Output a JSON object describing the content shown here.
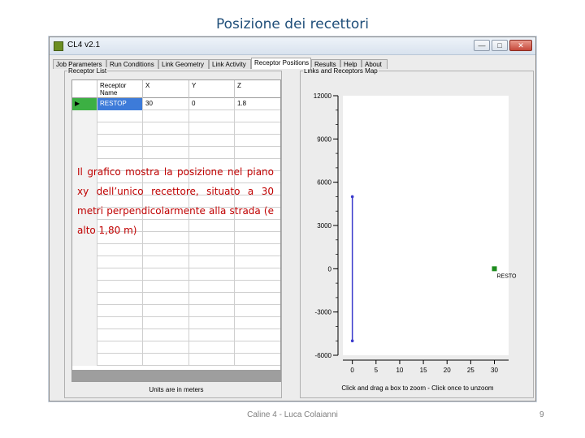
{
  "slide": {
    "title": "Posizione dei recettori",
    "overlay": "Il grafico mostra la posizione nel piano xy dell’unico recettore, situato a 30 metri perpendicolarmente alla strada (e alto 1,80 m)",
    "footer": "Caline 4 - Luca Colaianni",
    "page_number": "9"
  },
  "window": {
    "title": "CL4 v2.1",
    "minimize": "—",
    "maximize": "□",
    "close": "✕"
  },
  "tabs": [
    {
      "label": "Job Parameters"
    },
    {
      "label": "Run Conditions"
    },
    {
      "label": "Link Geometry"
    },
    {
      "label": "Link Activity"
    },
    {
      "label": "Receptor Positions"
    },
    {
      "label": "Results"
    },
    {
      "label": "Help"
    },
    {
      "label": "About"
    }
  ],
  "left_panel": {
    "label": "Receptor List",
    "columns": [
      "Receptor Name",
      "X",
      "Y",
      "Z"
    ],
    "rows": [
      {
        "marker": "▶",
        "name": "RESTOP",
        "x": "30",
        "y": "0",
        "z": "1.8"
      }
    ],
    "units": "Units are in meters"
  },
  "right_panel": {
    "label": "Links and Receptors Map",
    "hint": "Click and drag a box to zoom - Click once to unzoom"
  },
  "chart_data": {
    "type": "scatter",
    "title": "",
    "xlabel": "",
    "ylabel": "",
    "xlim": [
      -2,
      33
    ],
    "ylim": [
      -6000,
      12000
    ],
    "x_ticks": [
      "0",
      "5",
      "10",
      "15",
      "20",
      "25",
      "30"
    ],
    "y_ticks": [
      "12000",
      "9000",
      "6000",
      "3000",
      "0",
      "-3000",
      "-6000"
    ],
    "links": [
      {
        "x": [
          0,
          0
        ],
        "y": [
          5000,
          -5000
        ],
        "color": "#3a3acc"
      }
    ],
    "receptors": [
      {
        "label": "RESTO",
        "x": 30,
        "y": 0,
        "color": "#1e8c1e"
      }
    ],
    "grid": false
  }
}
